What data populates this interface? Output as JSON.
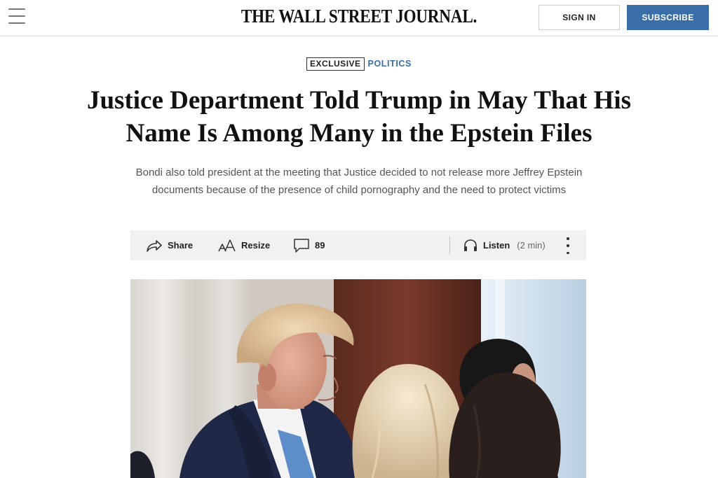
{
  "header": {
    "logo_text": "THE WALL STREET JOURNAL.",
    "menu_icon": "hamburger-menu-icon",
    "sign_in_label": "SIGN IN",
    "subscribe_label": "SUBSCRIBE",
    "subscribe_color": "#3a6ea8"
  },
  "article": {
    "flag": "EXCLUSIVE",
    "section": "POLITICS",
    "section_color": "#3a6ea8",
    "headline": "Justice Department Told Trump in May That His Name Is Among Many in the Epstein Files",
    "dek": "Bondi also told president at the meeting that Justice decided to not release more Jeffrey Epstein documents because of the presence of child pornography and the need to protect victims"
  },
  "toolbar": {
    "share_label": "Share",
    "share_icon": "share-arrow-icon",
    "resize_label": "Resize",
    "resize_icon": "text-resize-icon",
    "comments_count": "89",
    "comments_icon": "comment-bubble-icon",
    "listen_label": "Listen",
    "listen_icon": "headphones-icon",
    "listen_duration": "(2 min)",
    "more_icon": "more-vertical-icon"
  }
}
